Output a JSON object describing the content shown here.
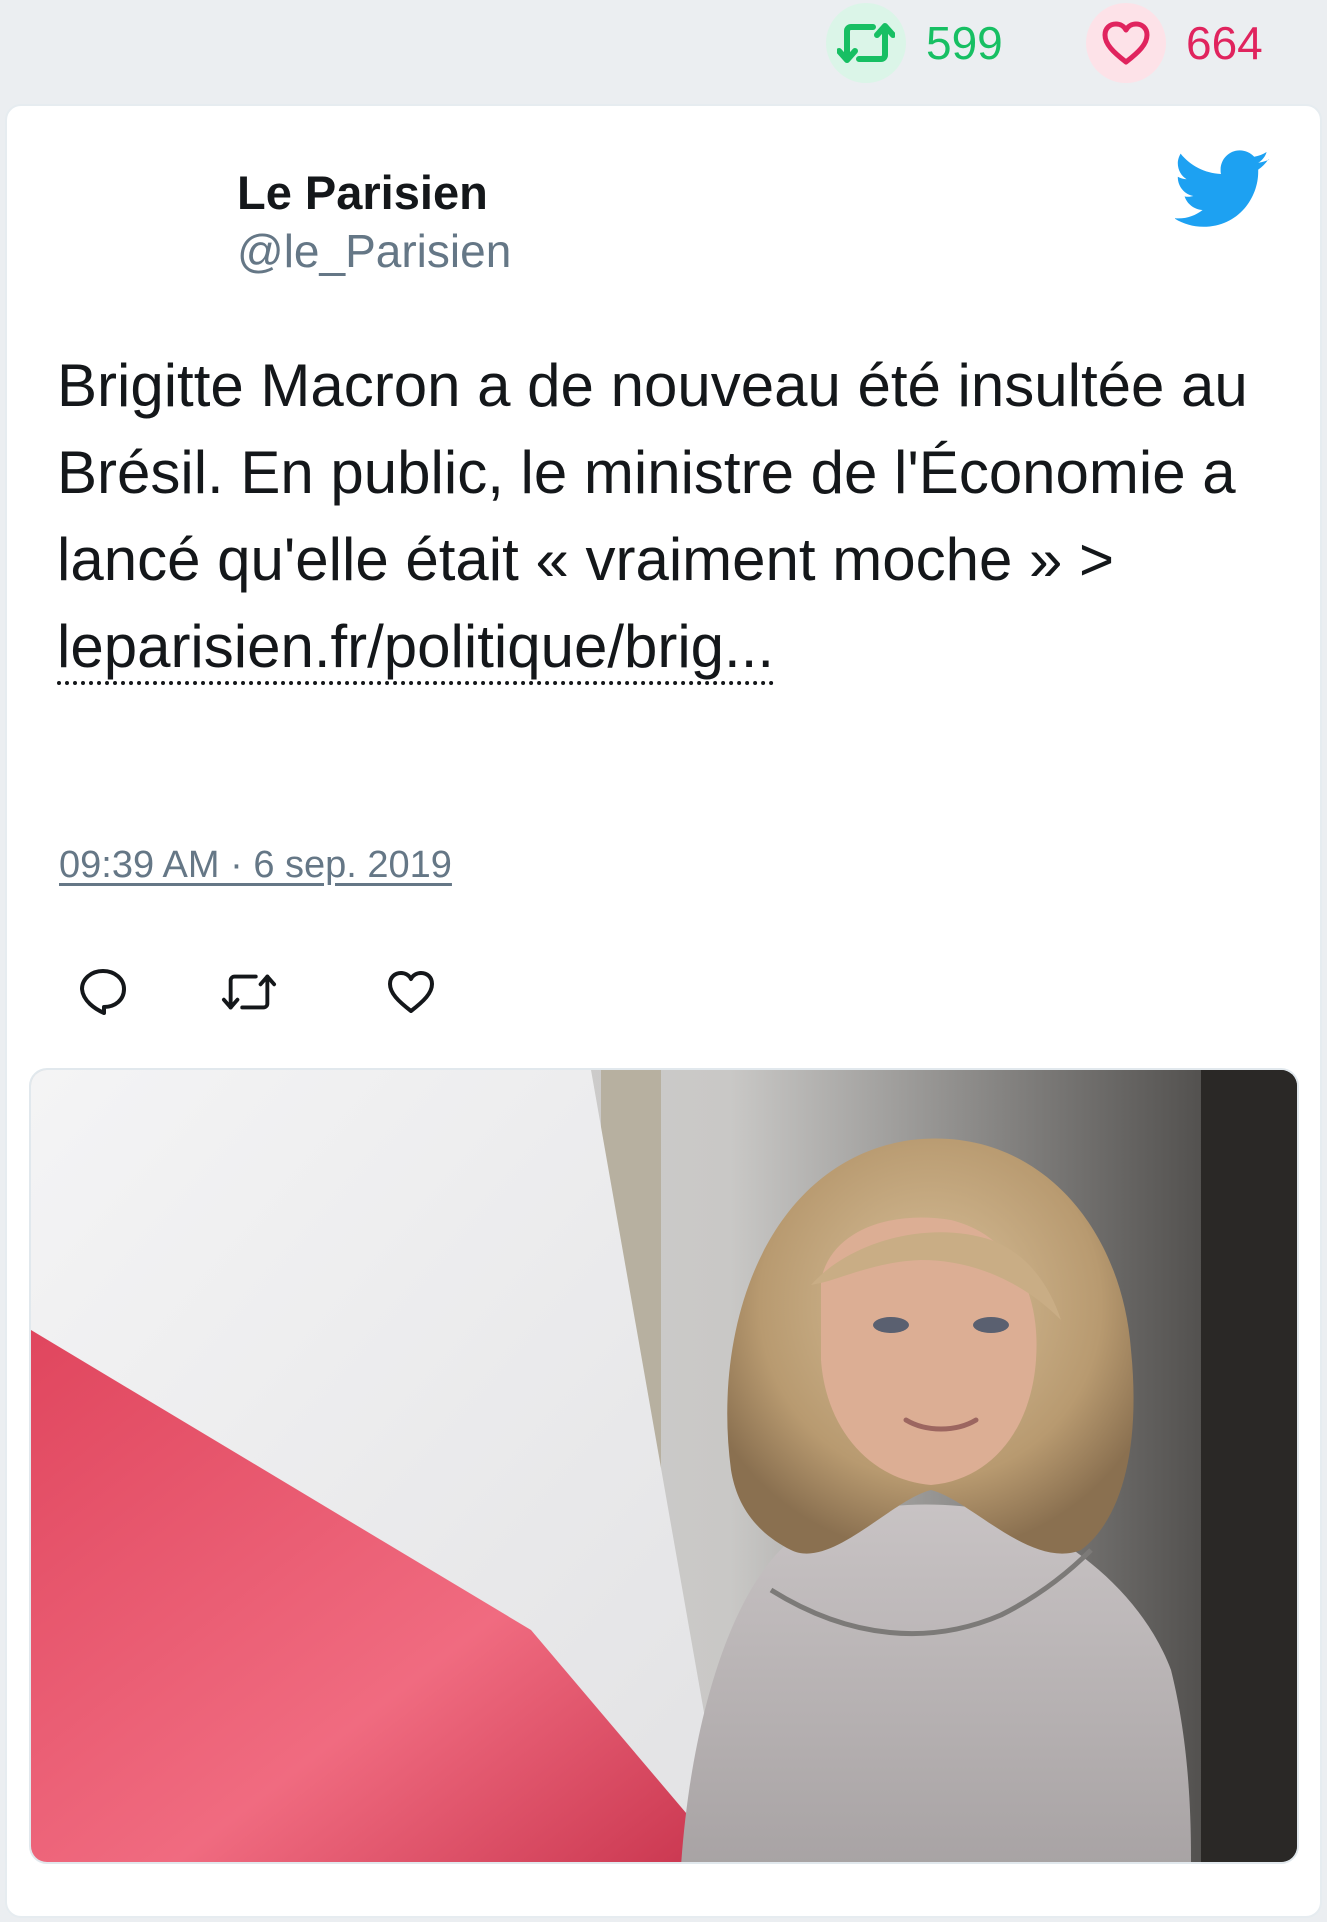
{
  "stats": {
    "retweets": {
      "icon": "retweet-icon",
      "count": "599",
      "color": "#17bf63"
    },
    "likes": {
      "icon": "heart-icon",
      "count": "664",
      "color": "#e0245e"
    }
  },
  "tweet": {
    "author_name": "Le Parisien",
    "author_handle": "@le_Parisien",
    "text": "Brigitte Macron a de nouveau été insultée au Brésil. En public, le ministre de l'Économie a lancé qu'elle était « vraiment moche » > ",
    "link_text": "leparisien.fr/politique/brig...",
    "timestamp": "09:39 AM · 6 sep. 2019",
    "brand_color": "#1da1f2",
    "actions": [
      "reply-icon",
      "retweet-icon",
      "heart-icon"
    ]
  },
  "media": {
    "icon": "photo"
  }
}
